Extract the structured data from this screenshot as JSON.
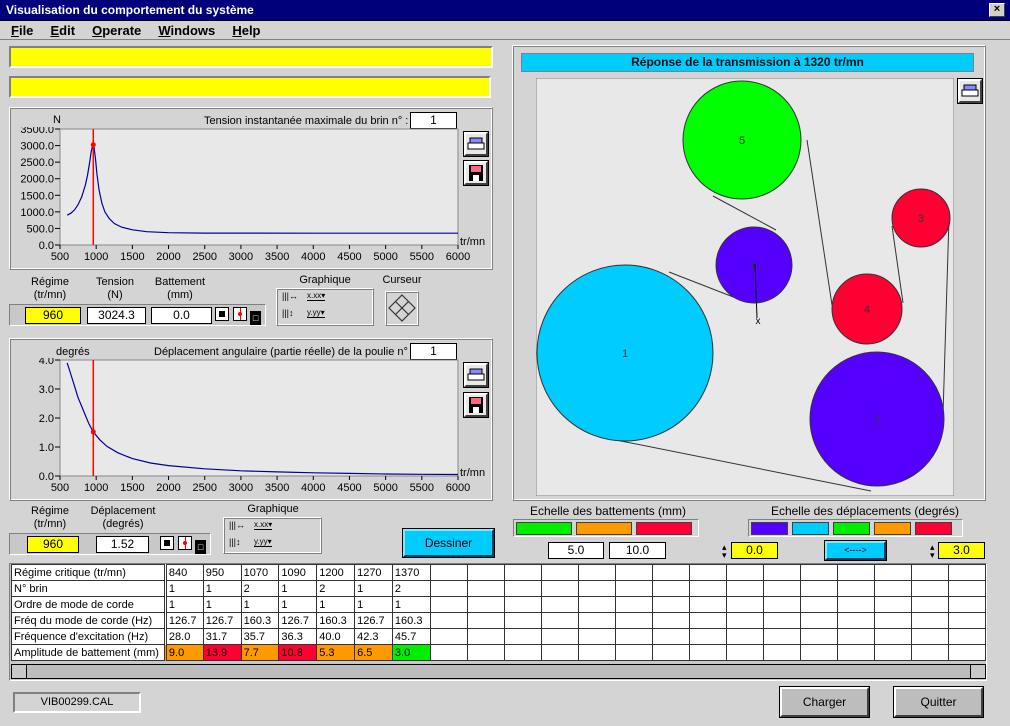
{
  "window": {
    "title": "Visualisation du comportement du système",
    "close_label": "×"
  },
  "menu": [
    "File",
    "Edit",
    "Operate",
    "Windows",
    "Help"
  ],
  "status_bars": [
    "",
    ""
  ],
  "tension_panel": {
    "unit_label": "N",
    "title": "Tension instantanée maximale du brin n° :",
    "brin_number": "1",
    "x_unit": "tr/mn",
    "readouts": {
      "regime_label": "Régime\n(tr/mn)",
      "regime_value": "960",
      "tension_label": "Tension\n(N)",
      "tension_value": "3024.3",
      "battement_label": "Battement\n(mm)",
      "battement_value": "0.0"
    },
    "graphique_label": "Graphique",
    "curseur_label": "Curseur"
  },
  "displacement_panel": {
    "unit_label": "degrés",
    "title": "Déplacement angulaire (partie réelle) de la poulie n° :",
    "poulie_number": "1",
    "x_unit": "tr/mn",
    "readouts": {
      "regime_label": "Régime\n(tr/mn)",
      "regime_value": "960",
      "deplacement_label": "Déplacement\n(degrés)",
      "deplacement_value": "1.52"
    },
    "graphique_label": "Graphique"
  },
  "dessiner_label": "Dessiner",
  "transmission": {
    "title": "Réponse de la transmission à 1320 tr/mn",
    "pulleys": [
      {
        "id": "1",
        "color": "#00ccff"
      },
      {
        "id": "2",
        "color": "#5500ff"
      },
      {
        "id": "3",
        "color": "#ff0033"
      },
      {
        "id": "4",
        "color": "#ff0033"
      },
      {
        "id": "5",
        "color": "#00ff00"
      },
      {
        "id": "6",
        "color": "#5500ff"
      }
    ],
    "tensioner_marker": "x"
  },
  "scales": {
    "battements_label": "Echelle des battements (mm)",
    "battements_colors": [
      "#00ee00",
      "#ff9900",
      "#ff0033"
    ],
    "battements_thresholds": [
      "5.0",
      "10.0"
    ],
    "deplacements_label": "Echelle des déplacements (degrés)",
    "deplacements_colors": [
      "#5500ff",
      "#00ccff",
      "#00ee00",
      "#ff9900",
      "#ff0033"
    ],
    "deplacements_min": "0.0",
    "deplacements_max": "3.0",
    "swap_label": "<---->"
  },
  "table": {
    "row_labels": [
      "Régime critique (tr/mn)",
      "N° brin",
      "Ordre de mode de corde",
      "Fréq du mode de corde (Hz)",
      "Fréquence d'excitation (Hz)",
      "Amplitude de battement (mm)"
    ],
    "columns": [
      [
        "840",
        "1",
        "1",
        "126.7",
        "28.0",
        "9.0"
      ],
      [
        "950",
        "1",
        "1",
        "126.7",
        "31.7",
        "13.9"
      ],
      [
        "1070",
        "2",
        "1",
        "160.3",
        "35.7",
        "7.7"
      ],
      [
        "1090",
        "1",
        "1",
        "126.7",
        "36.3",
        "10.8"
      ],
      [
        "1200",
        "2",
        "1",
        "160.3",
        "40.0",
        "5.3"
      ],
      [
        "1270",
        "1",
        "1",
        "126.7",
        "42.3",
        "6.5"
      ],
      [
        "1370",
        "2",
        "1",
        "160.3",
        "45.7",
        "3.0"
      ]
    ],
    "amplitude_colors": [
      "#ff9900",
      "#ff0033",
      "#ff9900",
      "#ff0033",
      "#ff9900",
      "#ff9900",
      "#00ee00"
    ],
    "empty_columns": 15
  },
  "footer": {
    "filename": "VIB00299.CAL",
    "charger_label": "Charger",
    "quitter_label": "Quitter"
  },
  "chart_data": [
    {
      "type": "line",
      "title": "Tension instantanée maximale du brin n° : 1",
      "xlabel": "tr/mn",
      "ylabel": "N",
      "xlim": [
        500,
        6000
      ],
      "ylim": [
        0,
        3500
      ],
      "xticks": [
        "500",
        "1000",
        "1500",
        "2000",
        "2500",
        "3000",
        "3500",
        "4000",
        "4500",
        "5000",
        "5500",
        "6000"
      ],
      "yticks": [
        "0.0",
        "500.0",
        "1000.0",
        "1500.0",
        "2000.0",
        "2500.0",
        "3000.0",
        "3500.0"
      ],
      "cursor_x": 960,
      "cursor_y": 3024.3,
      "series": [
        {
          "name": "tension",
          "color": "#000099",
          "x": [
            600,
            650,
            700,
            750,
            800,
            850,
            880,
            910,
            930,
            950,
            960,
            970,
            990,
            1010,
            1040,
            1080,
            1120,
            1180,
            1250,
            1350,
            1500,
            1700,
            2000,
            2500,
            3000,
            4000,
            5000,
            6000
          ],
          "y": [
            900,
            960,
            1060,
            1220,
            1450,
            1800,
            2100,
            2500,
            2800,
            3000,
            3024,
            2950,
            2600,
            2150,
            1650,
            1250,
            1000,
            800,
            650,
            540,
            460,
            400,
            370,
            360,
            360,
            355,
            355,
            355
          ]
        }
      ]
    },
    {
      "type": "line",
      "title": "Déplacement angulaire (partie réelle) de la poulie n° : 1",
      "xlabel": "tr/mn",
      "ylabel": "degrés",
      "xlim": [
        500,
        6000
      ],
      "ylim": [
        0,
        4
      ],
      "xticks": [
        "500",
        "1000",
        "1500",
        "2000",
        "2500",
        "3000",
        "3500",
        "4000",
        "4500",
        "5000",
        "5500",
        "6000"
      ],
      "yticks": [
        "0.0",
        "1.0",
        "2.0",
        "3.0",
        "4.0"
      ],
      "cursor_x": 960,
      "cursor_y": 1.52,
      "series": [
        {
          "name": "deplacement",
          "color": "#000099",
          "x": [
            600,
            650,
            700,
            750,
            800,
            850,
            900,
            960,
            1050,
            1150,
            1300,
            1500,
            1750,
            2000,
            2500,
            3000,
            3500,
            4000,
            4500,
            5000,
            5500,
            6000
          ],
          "y": [
            3.9,
            3.5,
            3.1,
            2.7,
            2.4,
            2.1,
            1.8,
            1.52,
            1.25,
            1.02,
            0.8,
            0.6,
            0.45,
            0.36,
            0.25,
            0.18,
            0.14,
            0.11,
            0.09,
            0.07,
            0.06,
            0.05
          ]
        }
      ]
    }
  ]
}
